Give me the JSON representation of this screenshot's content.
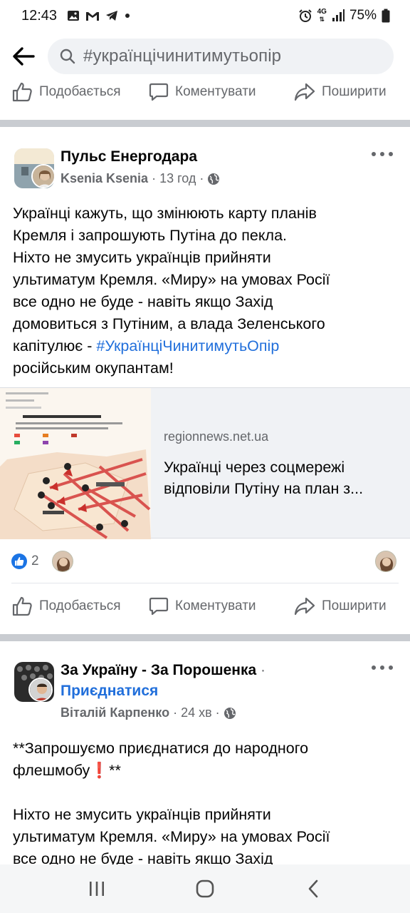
{
  "status_bar": {
    "time": "12:43",
    "network": "4G",
    "battery": "75%",
    "icons": [
      "gallery-icon",
      "gmail-icon",
      "telegram-icon",
      "dot-icon",
      "alarm-icon",
      "4g-icon",
      "signal-icon",
      "battery-icon"
    ]
  },
  "search": {
    "query": "#українцічинитимутьопір"
  },
  "actions": {
    "like": "Подобається",
    "comment": "Коментувати",
    "share": "Поширити"
  },
  "post1": {
    "page_name": "Пульс Енергодара",
    "author": "Ksenia Ksenia",
    "time": "13 год",
    "privacy_icon": "globe-icon",
    "text_lines": [
      "Українці кажуть, що змінюють карту планів",
      "Кремля і запрошують Путіна до пекла.",
      "Ніхто не змусить українців прийняти",
      "ультиматум Кремля. «Миру» на умовах Росії",
      "все одно не буде - навіть якщо Захід",
      "домовиться з Путіним, а влада Зеленського"
    ],
    "text_line7_prefix": "капітулює - ",
    "hashtag": "#УкраїнціЧинитимутьОпір",
    "text_line8": "російським окупантам!",
    "link": {
      "domain": "regionnews.net.ua",
      "title_line1": "Українці через соцмережі",
      "title_line2": "відповіли Путіну на план з..."
    },
    "reactions": {
      "count": "2"
    }
  },
  "post2": {
    "page_name": "За Україну - За Порошенка",
    "join_label": "Приєднатися",
    "author": "Віталій Карпенко",
    "time": "24 хв",
    "privacy_icon": "globe-icon",
    "line1": "**Запрошуємо приєднатися до народного",
    "line2_a": "флешмобу",
    "line2_b": "**",
    "line3": "Ніхто не змусить українців прийняти",
    "line4": "ультиматум Кремля. «Миру» на умовах Росії",
    "line5": "все одно не буде - навіть якщо Захід"
  },
  "colors": {
    "accent": "#216fdb",
    "like_blue": "#1b74e4",
    "secondary_text": "#65676b",
    "divider": "#c9ccd1",
    "search_bg": "#f0f2f5"
  }
}
